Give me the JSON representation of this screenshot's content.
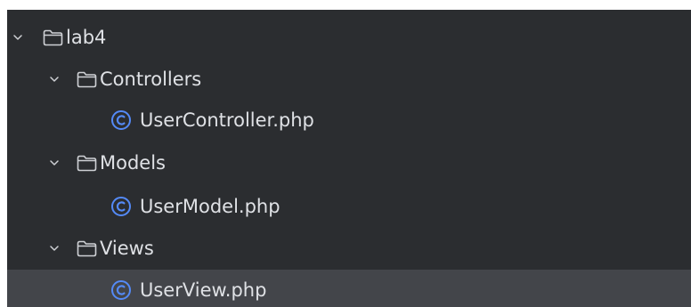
{
  "colors": {
    "panel_background": "#2b2d30",
    "selected_row": "#43454a",
    "text": "#dfe1e5",
    "class_icon": "#548af7"
  },
  "tree": {
    "root": {
      "label": "lab4",
      "icon": "folder-icon",
      "expanded": true
    },
    "folders": [
      {
        "label": "Controllers",
        "icon": "folder-icon",
        "expanded": true,
        "files": [
          {
            "label": "UserController.php",
            "icon": "class-icon"
          }
        ]
      },
      {
        "label": "Models",
        "icon": "folder-icon",
        "expanded": true,
        "files": [
          {
            "label": "UserModel.php",
            "icon": "class-icon"
          }
        ]
      },
      {
        "label": "Views",
        "icon": "folder-icon",
        "expanded": true,
        "files": [
          {
            "label": "UserView.php",
            "icon": "class-icon",
            "selected": true
          }
        ]
      }
    ]
  }
}
